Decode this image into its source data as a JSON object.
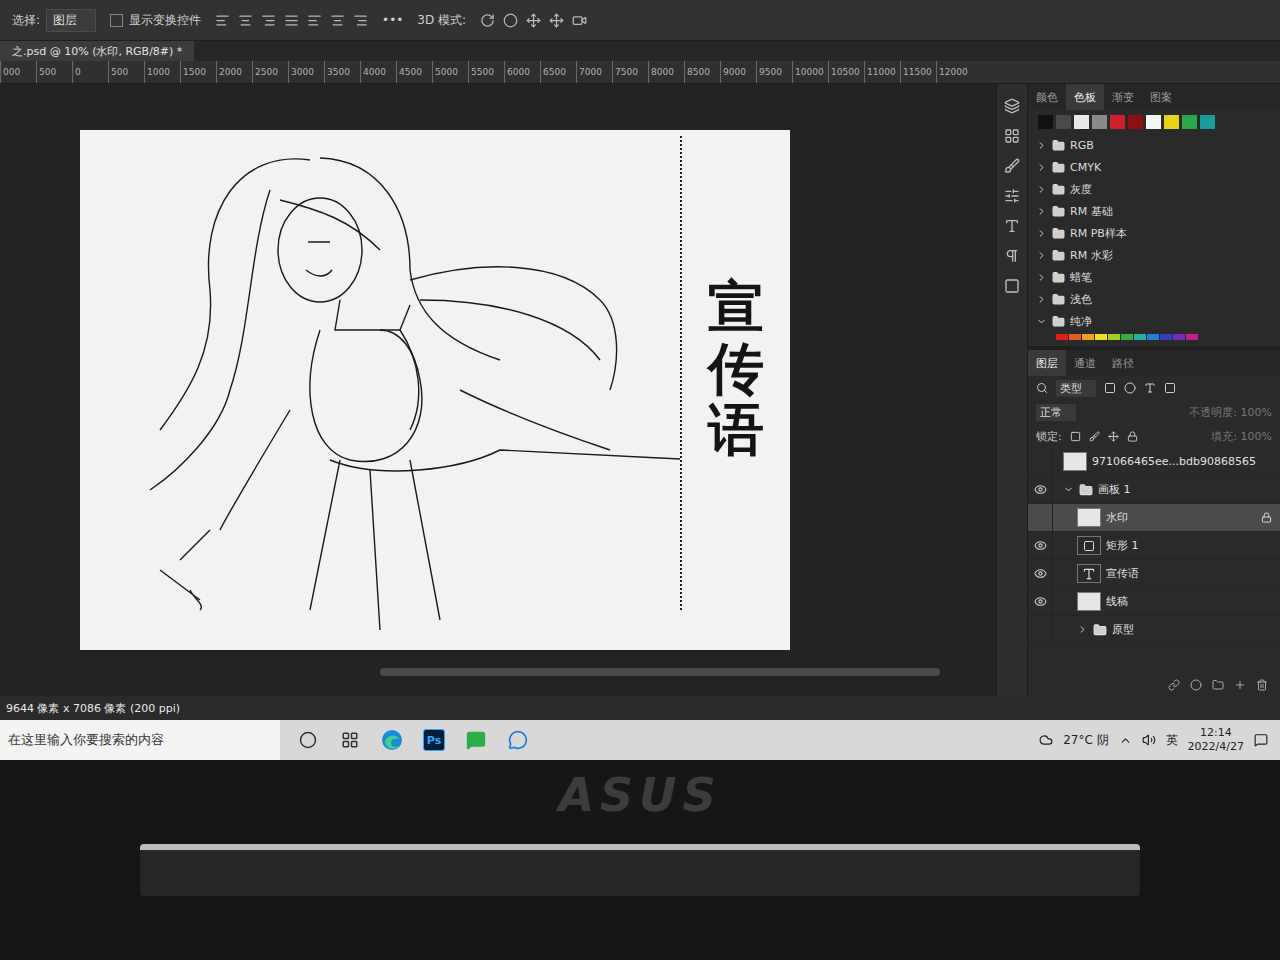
{
  "options_bar": {
    "select_label": "选择:",
    "select_value": "图层",
    "transform_checkbox": {
      "label": "显示变换控件",
      "checked": false
    },
    "more": "•••",
    "mode_label": "3D 模式:"
  },
  "document_tab": {
    "title": "之.psd @ 10% (水印, RGB/8#) *",
    "selected": true
  },
  "ruler": {
    "ticks": [
      "000",
      "500",
      "0",
      "500",
      "1000",
      "1500",
      "2000",
      "2500",
      "3000",
      "3500",
      "4000",
      "4500",
      "5000",
      "5500",
      "6000",
      "6500",
      "7000",
      "7500",
      "8000",
      "8500",
      "9000",
      "9500",
      "10000",
      "10500",
      "11000",
      "11500",
      "12000"
    ]
  },
  "canvas": {
    "slogan": "宣传语"
  },
  "swatches_panel": {
    "tabs": [
      {
        "label": "颜色",
        "selected": false
      },
      {
        "label": "色板",
        "selected": true
      },
      {
        "label": "渐变",
        "selected": false
      },
      {
        "label": "图案",
        "selected": false
      }
    ],
    "recent": [
      {
        "color": "#111111"
      },
      {
        "color": "#4a4a4a"
      },
      {
        "color": "#e8e8e8"
      },
      {
        "color": "#8a8a8a"
      },
      {
        "color": "#d0202a"
      },
      {
        "color": "#8c1010"
      },
      {
        "color": "#f4f4f4"
      },
      {
        "color": "#e8d21a"
      },
      {
        "color": "#2aa84a"
      },
      {
        "color": "#1a9a9a"
      }
    ],
    "groups": [
      {
        "name": "RGB",
        "expanded": false
      },
      {
        "name": "CMYK",
        "expanded": false
      },
      {
        "name": "灰度",
        "expanded": false
      },
      {
        "name": "RM 基础",
        "expanded": false
      },
      {
        "name": "RM PB样本",
        "expanded": false
      },
      {
        "name": "RM 水彩",
        "expanded": false
      },
      {
        "name": "蜡笔",
        "expanded": false
      },
      {
        "name": "浅色",
        "expanded": false
      },
      {
        "name": "纯净",
        "expanded": true
      }
    ],
    "expanded_colors": [
      {
        "color": "#e02020"
      },
      {
        "color": "#e85a1a"
      },
      {
        "color": "#f0a020"
      },
      {
        "color": "#f0e020"
      },
      {
        "color": "#a0d020"
      },
      {
        "color": "#30b040"
      },
      {
        "color": "#20b0a0"
      },
      {
        "color": "#2080d0"
      },
      {
        "color": "#3040c0"
      },
      {
        "color": "#7030b0"
      },
      {
        "color": "#c02090"
      }
    ]
  },
  "layers_panel": {
    "tabs": [
      {
        "label": "图层",
        "selected": true
      },
      {
        "label": "通道",
        "selected": false
      },
      {
        "label": "路径",
        "selected": false
      }
    ],
    "filter": "类型",
    "blend_mode": "正常",
    "opacity_label": "不透明度:",
    "opacity": "100%",
    "opacity_disabled": true,
    "lock_label": "锁定:",
    "fill_label": "填充:",
    "fill": "100%",
    "layers": [
      {
        "name": "971066465ee...bdb90868565",
        "kind": "image",
        "visible": false,
        "selected": false,
        "locked": false,
        "depth": 0
      },
      {
        "name": "画板 1",
        "kind": "group",
        "visible": true,
        "selected": false,
        "locked": false,
        "depth": 0,
        "expanded": true
      },
      {
        "name": "水印",
        "kind": "image",
        "visible": false,
        "selected": true,
        "locked": true,
        "depth": 1
      },
      {
        "name": "矩形 1",
        "kind": "shape",
        "visible": true,
        "selected": false,
        "locked": false,
        "depth": 1
      },
      {
        "name": "宣传语",
        "kind": "text",
        "visible": true,
        "selected": false,
        "locked": false,
        "depth": 1
      },
      {
        "name": "线稿",
        "kind": "image",
        "visible": true,
        "selected": false,
        "locked": false,
        "depth": 1
      },
      {
        "name": "原型",
        "kind": "folder",
        "visible": false,
        "selected": false,
        "locked": false,
        "depth": 1,
        "expanded": false
      }
    ]
  },
  "status_bar": {
    "dimensions": "9644 像素 x 7086 像素 (200 ppi)"
  },
  "taskbar": {
    "search_placeholder": "在这里输入你要搜索的内容",
    "apps": [
      {
        "kind": "edge",
        "label": ""
      },
      {
        "kind": "photoshop",
        "label": "Ps"
      },
      {
        "kind": "wechat",
        "label": ""
      },
      {
        "kind": "chat",
        "label": ""
      }
    ],
    "weather": "27°C 阴",
    "ime": "英",
    "time": "12:14",
    "date": "2022/4/27"
  },
  "laptop": {
    "brand": "ASUS"
  }
}
